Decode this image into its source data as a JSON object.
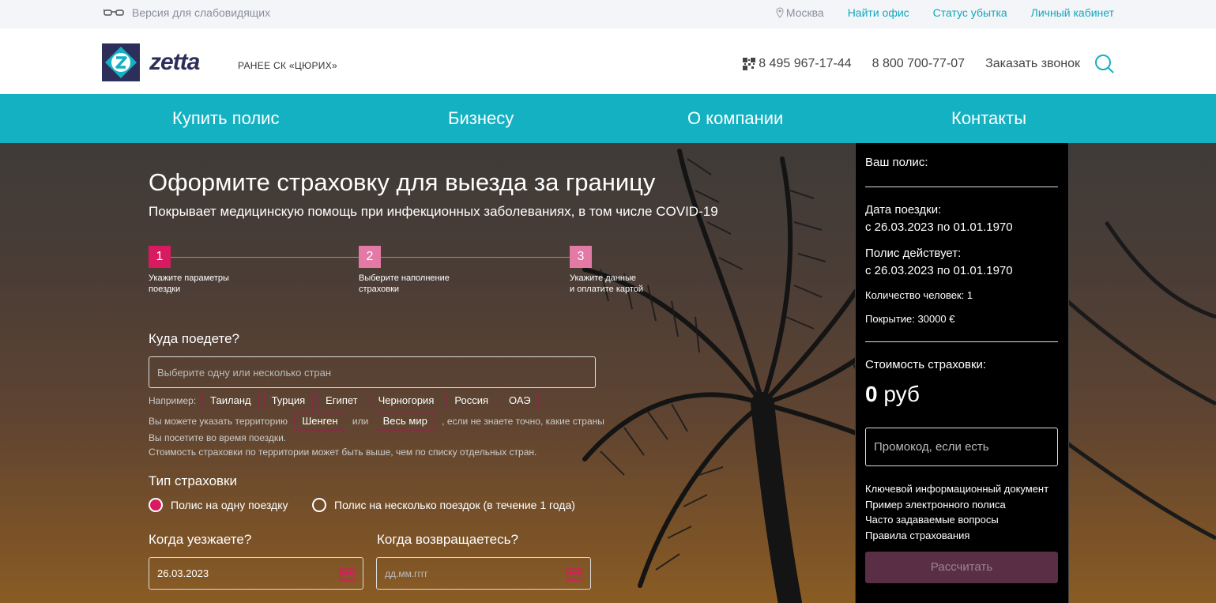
{
  "topbar": {
    "vision_label": "Версия для слабовидящих",
    "city": "Москва",
    "links": [
      "Найти офис",
      "Статус убытка",
      "Личный кабинет"
    ]
  },
  "header": {
    "logo_text": "zetta",
    "formerly": "РАНЕЕ СК «ЦЮРИХ»",
    "phone1": "8 495 967-17-44",
    "phone2": "8 800 700-77-07",
    "callback": "Заказать звонок"
  },
  "nav": [
    "Купить полис",
    "Бизнесу",
    "О компании",
    "Контакты"
  ],
  "hero": {
    "title": "Оформите страховку для выезда за границу",
    "subtitle": "Покрывает медицинскую помощь при инфекционных заболеваниях, в том числе COVID-19"
  },
  "steps": [
    {
      "num": "1",
      "label1": "Укажите параметры",
      "label2": "поездки"
    },
    {
      "num": "2",
      "label1": "Выберите наполнение",
      "label2": "страховки"
    },
    {
      "num": "3",
      "label1": "Укажите данные",
      "label2": "и оплатите картой"
    }
  ],
  "form": {
    "where_label": "Куда поедете?",
    "country_placeholder": "Выберите одну или несколько стран",
    "examples_label": "Например:",
    "examples": [
      "Таиланд",
      "Турция",
      "Египет",
      "Черногория",
      "Россия",
      "ОАЭ"
    ],
    "territory_prefix": "Вы можете указать территорию",
    "territory_schengen": "Шенген",
    "territory_or": "или",
    "territory_world": "Весь мир",
    "territory_suffix": ", если не знаете точно, какие страны Вы посетите во время поездки.",
    "territory_note": "Стоимость страховки по территории может быть выше, чем по списку отдельных стран.",
    "type_label": "Тип страховки",
    "type_single": "Полис на одну поездку",
    "type_multi": "Полис на несколько поездок (в течение 1 года)",
    "depart_label": "Когда уезжаете?",
    "depart_value": "26.03.2023",
    "return_label": "Когда возвращаетесь?",
    "return_placeholder": "дд.мм.гггг"
  },
  "sidebar": {
    "policy_label": "Ваш полис:",
    "trip_date_label": "Дата поездки:",
    "trip_date_value": "с 26.03.2023 по 01.01.1970",
    "valid_label": "Полис действует:",
    "valid_value": "с 26.03.2023 по 01.01.1970",
    "people": "Количество человек: 1",
    "coverage": "Покрытие: 30000 €",
    "cost_label": "Стоимость страховки:",
    "cost_value": "0",
    "cost_unit": "руб",
    "promo_placeholder": "Промокод, если есть",
    "docs": [
      "Ключевой информационный документ",
      "Пример электронного полиса",
      "Часто задаваемые вопросы",
      "Правила страхования"
    ],
    "calc_button": "Рассчитать"
  },
  "colors": {
    "accent": "#14b1c2",
    "step_active": "#d81b60",
    "step_inactive": "#e27aa5",
    "brand_dark": "#2d2f5a"
  }
}
